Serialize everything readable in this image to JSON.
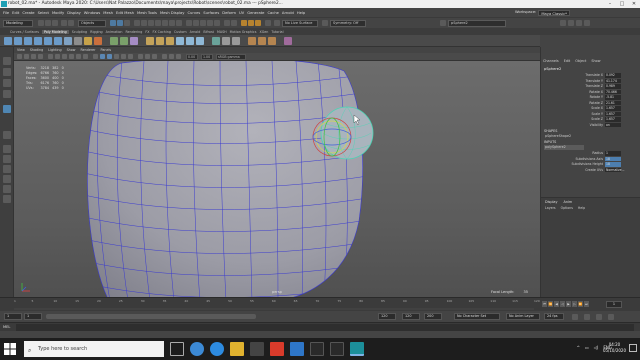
{
  "window": {
    "title": "robot_02.ma* - Autodesk Maya 2020: C:\\Users\\Nat Palazzo\\Documents\\maya\\projects\\Robot\\scenes\\robot_02.ma   ---   pSphere2...",
    "controls": [
      "–",
      "□",
      "✕"
    ]
  },
  "menubar": {
    "items": [
      "File",
      "Edit",
      "Create",
      "Select",
      "Modify",
      "Display",
      "Windows",
      "Mesh",
      "Edit Mesh",
      "Mesh Tools",
      "Mesh Display",
      "Curves",
      "Surfaces",
      "Deform",
      "UV",
      "Generate",
      "Cache",
      "Arnold",
      "Help"
    ],
    "workspace_label": "Workspace:",
    "workspace_value": "Maya Classic*"
  },
  "statusline": {
    "mode": "Modeling",
    "selection_field": "Objects",
    "live_surface": "No Live Surface",
    "symmetry": "Symmetry: Off",
    "object_name": "pSphere2"
  },
  "shelf": {
    "tabs": [
      "Curves / Surfaces",
      "Poly Modeling",
      "Sculpting",
      "Rigging",
      "Animation",
      "Rendering",
      "FX",
      "FX Caching",
      "Custom",
      "Arnold",
      "Bifrost",
      "MASH",
      "Motion Graphics",
      "XGen",
      "Tutorial"
    ],
    "active_tab": "Poly Modeling"
  },
  "panel": {
    "menu": [
      "View",
      "Shading",
      "Lighting",
      "Show",
      "Renderer",
      "Panels"
    ],
    "gamma": "sRGB gamma",
    "exposure": "0.00",
    "gamma_value": "1.00"
  },
  "hud": {
    "rows": [
      {
        "label": "Verts:",
        "a": "3218",
        "b": "382",
        "c": "0"
      },
      {
        "label": "Edges:",
        "a": "6766",
        "b": "760",
        "c": "0"
      },
      {
        "label": "Faces:",
        "a": "3600",
        "b": "400",
        "c": "0"
      },
      {
        "label": "Tris:",
        "a": "6176",
        "b": "760",
        "c": "0"
      },
      {
        "label": "UVs:",
        "a": "3784",
        "b": "439",
        "c": "0"
      }
    ],
    "camera": "persp",
    "focal_label": "Focal Length:",
    "focal_value": "35"
  },
  "channelbox": {
    "tabs": [
      "Channels",
      "Edit",
      "Object",
      "Show"
    ],
    "object": "pSphere2",
    "attributes": [
      {
        "name": "Translate X",
        "value": "0.092"
      },
      {
        "name": "Translate Y",
        "value": "41.174"
      },
      {
        "name": "Translate Z",
        "value": "0.989"
      },
      {
        "name": "Rotate X",
        "value": "70.466"
      },
      {
        "name": "Rotate Y",
        "value": "-5.81"
      },
      {
        "name": "Rotate Z",
        "value": "21.61"
      },
      {
        "name": "Scale X",
        "value": "1.657"
      },
      {
        "name": "Scale Y",
        "value": "1.657"
      },
      {
        "name": "Scale Z",
        "value": "1.657"
      },
      {
        "name": "Visibility",
        "value": "on"
      }
    ],
    "shapes_label": "SHAPES",
    "shape_name": "pSphereShape2",
    "inputs_label": "INPUTS",
    "input_name": "polySphere2",
    "input_attrs": [
      {
        "name": "Radius",
        "value": "1"
      },
      {
        "name": "Subdivisions Axis",
        "value": "18"
      },
      {
        "name": "Subdivisions Height",
        "value": "18"
      },
      {
        "name": "Create UVs",
        "value": "Normalize..."
      }
    ],
    "layer_tabs": [
      "Display",
      "Anim"
    ],
    "layer_menu": [
      "Layers",
      "Options",
      "Help"
    ]
  },
  "timeslider": {
    "ticks": [
      "1",
      "5",
      "10",
      "15",
      "20",
      "25",
      "30",
      "35",
      "40",
      "45",
      "50",
      "55",
      "60",
      "65",
      "70",
      "75",
      "80",
      "85",
      "90",
      "95",
      "100",
      "105",
      "110",
      "115",
      "120"
    ],
    "current_frame": "1"
  },
  "rangeslider": {
    "start": "1",
    "start2": "1",
    "end": "120",
    "end2": "120",
    "end3": "200",
    "char_set": "No Character Set",
    "anim_layer": "No Anim Layer",
    "fps": "24 fps"
  },
  "cmdline": {
    "mode": "MEL"
  },
  "taskbar": {
    "search_placeholder": "Type here to search",
    "tray_lang": "ENG",
    "time": "04:20",
    "date": "05/10/2020"
  },
  "colors": {
    "accent": "#4d7fb0",
    "wire": "#3b3bd0",
    "mesh": "#9a9aa6"
  }
}
